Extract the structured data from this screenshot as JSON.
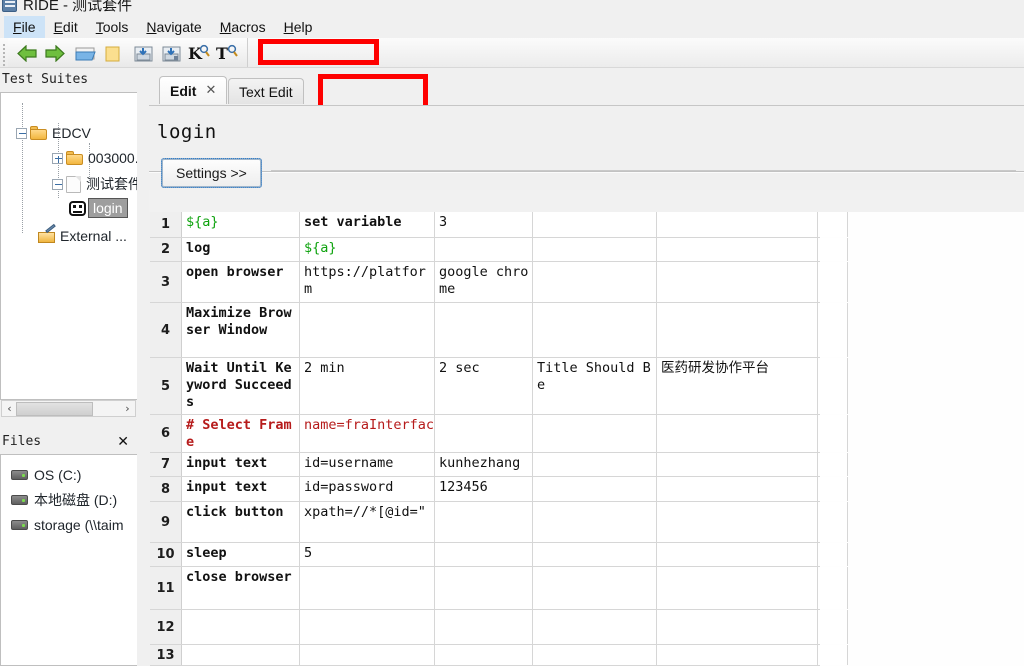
{
  "window": {
    "title": "RIDE - 测试套件",
    "logo_icon": "ride-app-icon"
  },
  "menubar": [
    {
      "label": "File",
      "accel": "F",
      "active": true
    },
    {
      "label": "Edit",
      "accel": "E",
      "active": false
    },
    {
      "label": "Tools",
      "accel": "T",
      "active": false
    },
    {
      "label": "Navigate",
      "accel": "N",
      "active": false
    },
    {
      "label": "Macros",
      "accel": "M",
      "active": false
    },
    {
      "label": "Help",
      "accel": "H",
      "active": false
    }
  ],
  "toolbar": {
    "buttons": [
      {
        "name": "back-arrow-icon",
        "tip": "Go Back"
      },
      {
        "name": "forward-arrow-icon",
        "tip": "Go Forward"
      },
      {
        "name": "open-folder-icon",
        "tip": "Open Directory"
      },
      {
        "name": "new-folder-icon",
        "tip": "New Project"
      },
      {
        "name": "save-icon",
        "tip": "Save"
      },
      {
        "name": "save-all-icon",
        "tip": "Save All"
      },
      {
        "name": "search-keyword-icon",
        "tip": "Search Keywords"
      },
      {
        "name": "search-tests-icon",
        "tip": "Search Tests"
      }
    ]
  },
  "annotations": [
    {
      "name": "annotation-rect-toolbar",
      "color": "#fe0000"
    },
    {
      "name": "annotation-rect-tabstrip",
      "color": "#fe0000"
    }
  ],
  "tree_panel": {
    "title": "Test Suites",
    "nodes": [
      {
        "label": "EDCV",
        "icon": "folder-icon",
        "toggle": "minus",
        "level": 0
      },
      {
        "label": "003000...",
        "icon": "folder-icon",
        "toggle": "plus",
        "level": 1
      },
      {
        "label": "测试套件",
        "icon": "document-icon",
        "toggle": "minus",
        "level": 1
      },
      {
        "label": "login",
        "icon": "robot-test-icon",
        "toggle": "none",
        "level": 2,
        "selected": true
      },
      {
        "label": "External ...",
        "icon": "external-resources-icon",
        "toggle": "none",
        "level": 1
      }
    ],
    "scrollbar": {
      "left_arrow": "‹",
      "right_arrow": "›"
    }
  },
  "files_panel": {
    "title": "Files",
    "close_label": "✕",
    "drives": [
      {
        "label": "OS (C:)",
        "icon": "drive-icon"
      },
      {
        "label": "本地磁盘 (D:)",
        "icon": "drive-icon"
      },
      {
        "label": "storage (\\\\taim",
        "icon": "network-drive-icon"
      }
    ]
  },
  "tabs": [
    {
      "label": "Edit",
      "active": true,
      "closable": true,
      "close_label": "✕"
    },
    {
      "label": "Text Edit",
      "active": false,
      "closable": false
    }
  ],
  "editor": {
    "title": "login",
    "settings_button": "Settings >>"
  },
  "grid": {
    "columns": [
      "",
      "",
      "",
      "",
      "",
      ""
    ],
    "rows": [
      {
        "num": "1",
        "cells": [
          {
            "text": "${a}",
            "style": "var"
          },
          {
            "text": "set variable",
            "style": "kw"
          },
          {
            "text": "3",
            "style": "plain"
          },
          {
            "text": "",
            "style": "plain"
          },
          {
            "text": "",
            "style": "plain"
          },
          {
            "text": "",
            "style": "plain"
          }
        ]
      },
      {
        "num": "2",
        "cells": [
          {
            "text": "log",
            "style": "kw"
          },
          {
            "text": "${a}",
            "style": "var"
          },
          {
            "text": "",
            "style": "plain"
          },
          {
            "text": "",
            "style": "plain"
          },
          {
            "text": "",
            "style": "plain"
          },
          {
            "text": "",
            "style": "plain"
          }
        ]
      },
      {
        "num": "3",
        "cells": [
          {
            "text": "open browser",
            "style": "kw"
          },
          {
            "text": "https://platform",
            "style": "plain"
          },
          {
            "text": "google chrome",
            "style": "plain"
          },
          {
            "text": "",
            "style": "plain"
          },
          {
            "text": "",
            "style": "plain"
          },
          {
            "text": "",
            "style": "plain"
          }
        ]
      },
      {
        "num": "4",
        "cells": [
          {
            "text": "Maximize Browser Window",
            "style": "kw"
          },
          {
            "text": "",
            "style": "plain"
          },
          {
            "text": "",
            "style": "plain"
          },
          {
            "text": "",
            "style": "plain"
          },
          {
            "text": "",
            "style": "plain"
          },
          {
            "text": "",
            "style": "plain"
          }
        ]
      },
      {
        "num": "5",
        "cells": [
          {
            "text": "Wait Until Keyword Succeeds",
            "style": "kw"
          },
          {
            "text": "2 min",
            "style": "plain"
          },
          {
            "text": "2 sec",
            "style": "plain"
          },
          {
            "text": "Title Should Be",
            "style": "plain"
          },
          {
            "text": "医药研发协作平台",
            "style": "cjk"
          },
          {
            "text": "",
            "style": "plain"
          }
        ]
      },
      {
        "num": "6",
        "cells": [
          {
            "text": "# Select Frame",
            "style": "comment"
          },
          {
            "text": "name=fraInterfac",
            "style": "comment"
          },
          {
            "text": "",
            "style": "plain"
          },
          {
            "text": "",
            "style": "plain"
          },
          {
            "text": "",
            "style": "plain"
          },
          {
            "text": "",
            "style": "plain"
          }
        ]
      },
      {
        "num": "7",
        "cells": [
          {
            "text": "input text",
            "style": "kw"
          },
          {
            "text": "id=username",
            "style": "plain"
          },
          {
            "text": "kunhezhang",
            "style": "plain"
          },
          {
            "text": "",
            "style": "plain"
          },
          {
            "text": "",
            "style": "plain"
          },
          {
            "text": "",
            "style": "plain"
          }
        ]
      },
      {
        "num": "8",
        "cells": [
          {
            "text": "input text",
            "style": "kw"
          },
          {
            "text": "id=password",
            "style": "plain"
          },
          {
            "text": "123456",
            "style": "plain"
          },
          {
            "text": "",
            "style": "plain"
          },
          {
            "text": "",
            "style": "plain"
          },
          {
            "text": "",
            "style": "plain"
          }
        ]
      },
      {
        "num": "9",
        "cells": [
          {
            "text": "click button",
            "style": "kw"
          },
          {
            "text": "xpath=//*[@id=\"",
            "style": "plain"
          },
          {
            "text": "",
            "style": "plain"
          },
          {
            "text": "",
            "style": "plain"
          },
          {
            "text": "",
            "style": "plain"
          },
          {
            "text": "",
            "style": "plain"
          }
        ]
      },
      {
        "num": "10",
        "cells": [
          {
            "text": "sleep",
            "style": "kw"
          },
          {
            "text": "5",
            "style": "plain"
          },
          {
            "text": "",
            "style": "plain"
          },
          {
            "text": "",
            "style": "plain"
          },
          {
            "text": "",
            "style": "plain"
          },
          {
            "text": "",
            "style": "plain"
          }
        ]
      },
      {
        "num": "11",
        "cells": [
          {
            "text": "close browser",
            "style": "kw"
          },
          {
            "text": "",
            "style": "plain"
          },
          {
            "text": "",
            "style": "plain"
          },
          {
            "text": "",
            "style": "plain"
          },
          {
            "text": "",
            "style": "plain"
          },
          {
            "text": "",
            "style": "plain"
          }
        ]
      },
      {
        "num": "12",
        "cells": [
          {
            "text": "",
            "style": "plain"
          },
          {
            "text": "",
            "style": "plain"
          },
          {
            "text": "",
            "style": "plain"
          },
          {
            "text": "",
            "style": "plain"
          },
          {
            "text": "",
            "style": "plain"
          },
          {
            "text": "",
            "style": "plain"
          }
        ]
      },
      {
        "num": "13",
        "cells": [
          {
            "text": "",
            "style": "plain"
          },
          {
            "text": "",
            "style": "plain"
          },
          {
            "text": "",
            "style": "plain"
          },
          {
            "text": "",
            "style": "plain"
          },
          {
            "text": "",
            "style": "plain"
          },
          {
            "text": "",
            "style": "plain"
          }
        ]
      }
    ]
  },
  "colors": {
    "annotation": "#fe0000",
    "variable": "#0fa30f",
    "comment": "#b61b1b",
    "selection": "#9e9e9e",
    "menu_active": "#cde3f7"
  }
}
